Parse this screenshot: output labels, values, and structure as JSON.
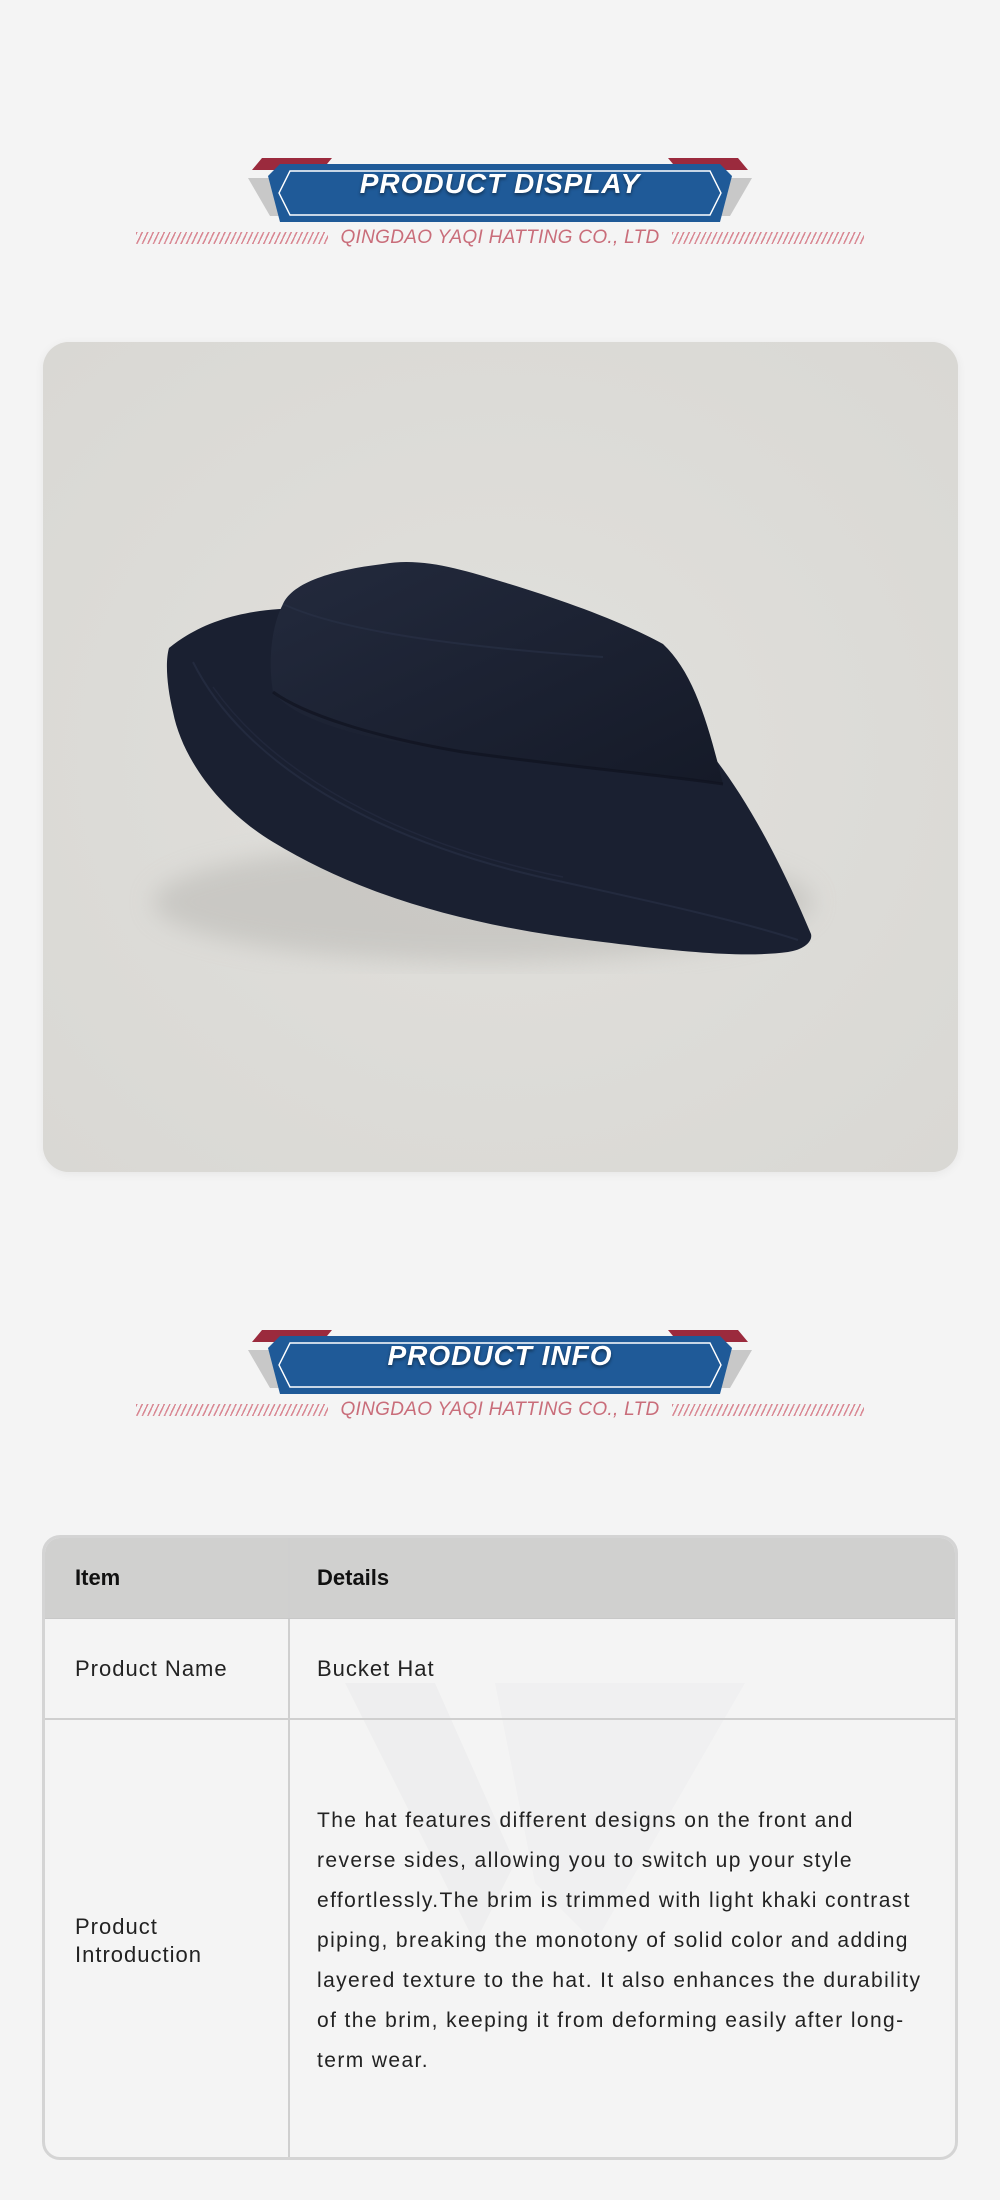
{
  "display_section": {
    "title": "PRODUCT DISPLAY",
    "subtitle": "QINGDAO YAQI HATTING CO., LTD"
  },
  "product_image": {
    "subject": "navy bucket hat on light grey background",
    "hat_color": "#1c2233",
    "background_color": "#dddcd8"
  },
  "info_section": {
    "title": "PRODUCT INFO",
    "subtitle": "QINGDAO YAQI HATTING CO., LTD"
  },
  "table": {
    "headers": [
      "Item",
      "Details"
    ],
    "rows": [
      {
        "item": "Product Name",
        "details": "Bucket Hat"
      },
      {
        "item": "Product Introduction",
        "details": "The hat features different designs on the front and reverse sides, allowing you to switch up your style effortlessly.The brim is trimmed with light khaki contrast piping, breaking the monotony of solid color and adding layered texture to the hat. It also enhances the durability of the brim, keeping it from deforming easily after long-term wear."
      }
    ]
  },
  "colors": {
    "banner_blue": "#1f5a98",
    "banner_red": "#9b2a3d",
    "banner_grey": "#c8c8c8",
    "subtitle_pink": "#c96d7a",
    "table_header_bg": "#d0d0cf"
  }
}
